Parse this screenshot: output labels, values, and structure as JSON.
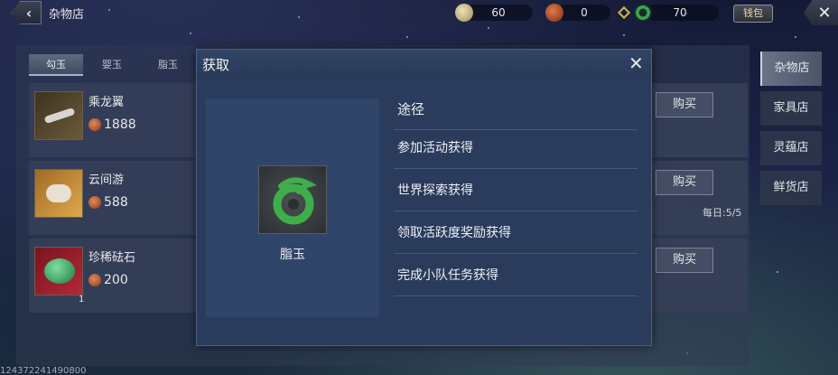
{
  "header": {
    "title": "杂物店",
    "back_icon": "chevron-left-icon",
    "close_icon": "close-icon",
    "exchange_label": "钱包"
  },
  "currencies": [
    {
      "icon": "silver-coin-icon",
      "value": "60",
      "color": "#d6c38a"
    },
    {
      "icon": "copper-coin-icon",
      "value": "0",
      "color": "#c0603a"
    },
    {
      "icon": "jade-icon",
      "value": "70",
      "color": "#3aa55a"
    }
  ],
  "tabs": [
    {
      "label": "勾玉",
      "active": true
    },
    {
      "label": "婴玉",
      "active": false
    },
    {
      "label": "脂玉",
      "active": false
    }
  ],
  "items": [
    {
      "name": "乘龙翼",
      "price": "1888",
      "qty": "",
      "buy_label": "购买",
      "icon": "wing-item-icon"
    },
    {
      "name": "云间游",
      "price": "588",
      "qty": "",
      "buy_label": "购买",
      "icon": "cloud-item-icon"
    },
    {
      "name": "珍稀砝石",
      "price": "200",
      "qty": "1",
      "buy_label": "购买",
      "icon": "green-stone-icon"
    }
  ],
  "daily_limit": "每日:5/5",
  "sidebar": [
    {
      "label": "杂物店",
      "active": true
    },
    {
      "label": "家具店",
      "active": false
    },
    {
      "label": "灵蕴店",
      "active": false
    },
    {
      "label": "鲜货店",
      "active": false
    }
  ],
  "footer_id": "124372241490800",
  "modal": {
    "title": "获取",
    "item_name": "脂玉",
    "item_icon": "jade-ring-icon",
    "ways_header": "途径",
    "ways": [
      "参加活动获得",
      "世界探索获得",
      "领取活跃度奖励获得",
      "完成小队任务获得"
    ]
  }
}
